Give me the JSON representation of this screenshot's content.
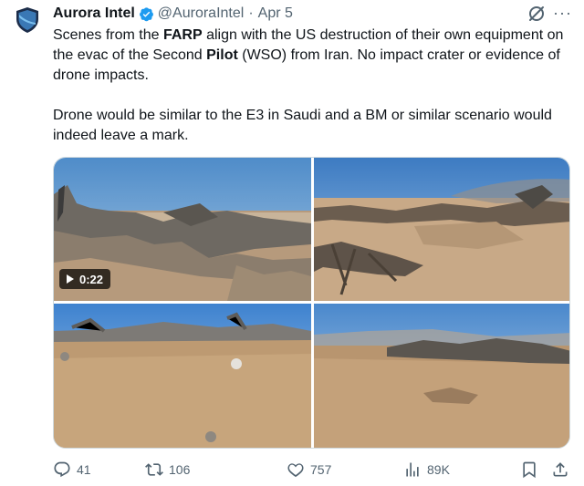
{
  "author": {
    "name": "Aurora Intel",
    "handle": "@AuroraIntel",
    "separator": "·",
    "date": "Apr 5",
    "avatar_icon": "shield-logo-icon",
    "verified_icon": "verified-badge-icon"
  },
  "tweet": {
    "p1_a": "Scenes from the ",
    "p1_b": "FARP",
    "p1_c": " align with the US destruction of their own equipment on the evac of the Second ",
    "p1_d": "Pilot",
    "p1_e": " (WSO) from Iran. No impact crater or evidence of drone impacts.",
    "p2": "Drone would be similar to the E3 in Saudi and a BM or similar scenario would indeed leave a mark."
  },
  "media": {
    "video_duration": "0:22"
  },
  "actions": {
    "replies": "41",
    "reposts": "106",
    "likes": "757",
    "views": "89K"
  },
  "colors": {
    "text": "#0f1419",
    "secondary": "#536471",
    "verified": "#1d9bf0",
    "border": "#cfd9de"
  }
}
